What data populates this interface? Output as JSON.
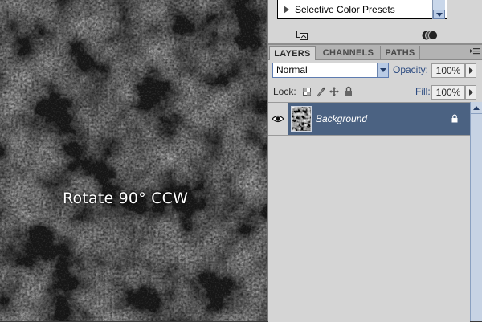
{
  "canvas": {
    "caption": "Rotate 90° CCW"
  },
  "actions": {
    "items": [
      {
        "label": "Selective Color Presets",
        "icon": "expand-triangle-icon"
      }
    ],
    "footer_icons": [
      "new-snapshot-icon",
      "cycle-icon"
    ]
  },
  "layers_panel": {
    "tabs": [
      {
        "label": "LAYERS",
        "active": true
      },
      {
        "label": "CHANNELS",
        "active": false
      },
      {
        "label": "PATHS",
        "active": false
      }
    ],
    "blend_mode": "Normal",
    "opacity_label": "Opacity:",
    "opacity_value": "100%",
    "lock_label": "Lock:",
    "lock_icons": [
      "lock-transparent-icon",
      "lock-image-icon",
      "lock-position-icon",
      "lock-all-icon"
    ],
    "fill_label": "Fill:",
    "fill_value": "100%",
    "layers": [
      {
        "name": "Background",
        "visible": true,
        "locked": true,
        "selected": true
      }
    ]
  },
  "colors": {
    "panel_bg": "#d5d5d5",
    "selected_layer": "#4b6282",
    "accent_text": "#2b4a80",
    "scrollbar": "#c7d3e4"
  }
}
